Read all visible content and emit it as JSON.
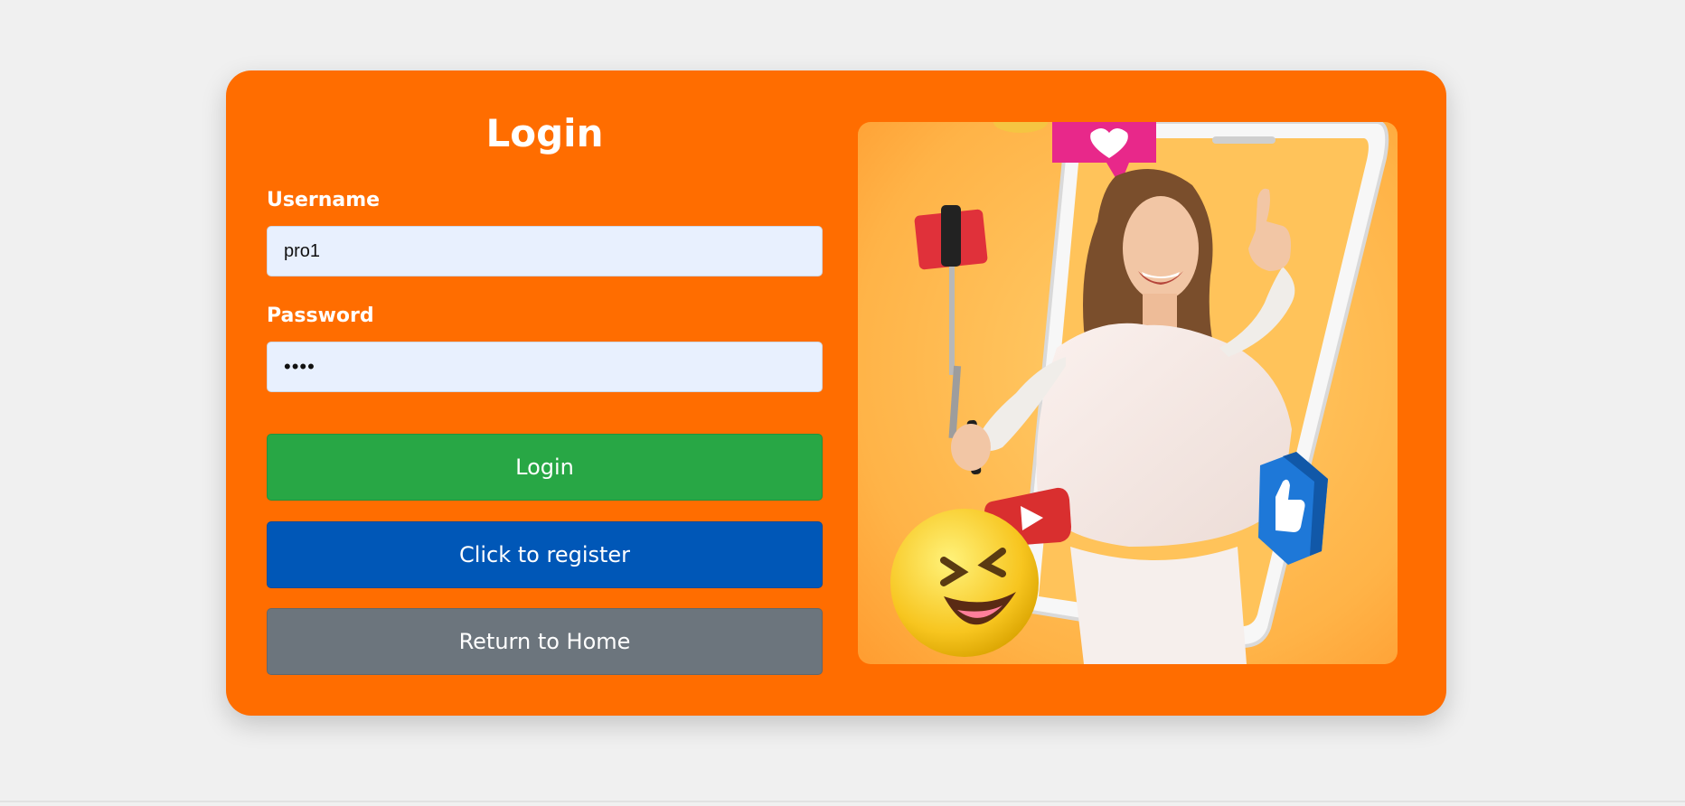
{
  "login_form": {
    "title": "Login",
    "username_label": "Username",
    "username_value": "pro1",
    "password_label": "Password",
    "password_value": "pass",
    "login_button": "Login",
    "register_button": "Click to register",
    "home_button": "Return to Home"
  },
  "colors": {
    "page_background": "#f0f0f0",
    "card_background": "#ff6d00",
    "login_button": "#28a745",
    "register_button": "#0057b7",
    "home_button": "#6c757d",
    "input_background": "#e8f0fe"
  },
  "hero_image": {
    "icons": [
      "heart-notification-icon",
      "selfie-stick-icon",
      "youtube-play-icon",
      "thumbs-up-icon",
      "laughing-emoji-icon"
    ]
  }
}
